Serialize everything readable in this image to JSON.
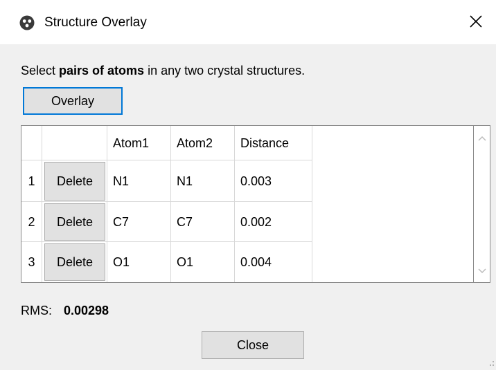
{
  "window": {
    "title": "Structure Overlay",
    "app_icon": "structure-app-icon",
    "close_icon": "close-icon"
  },
  "instruction": {
    "prefix": "Select ",
    "bold": "pairs of atoms",
    "suffix": " in any two crystal structures."
  },
  "overlay_button": {
    "label": "Overlay"
  },
  "table": {
    "headers": [
      "",
      "",
      "Atom1",
      "Atom2",
      "Distance"
    ],
    "rows": [
      {
        "num": "1",
        "delete_label": "Delete",
        "atom1": "N1",
        "atom2": "N1",
        "distance": "0.003"
      },
      {
        "num": "2",
        "delete_label": "Delete",
        "atom1": "C7",
        "atom2": "C7",
        "distance": "0.002"
      },
      {
        "num": "3",
        "delete_label": "Delete",
        "atom1": "O1",
        "atom2": "O1",
        "distance": "0.004"
      }
    ]
  },
  "rms": {
    "label": "RMS:",
    "value": "0.00298"
  },
  "close_button": {
    "label": "Close"
  },
  "colors": {
    "focus_border": "#0078d7",
    "button_bg": "#e1e1e1",
    "dialog_bg": "#f0f0f0"
  }
}
